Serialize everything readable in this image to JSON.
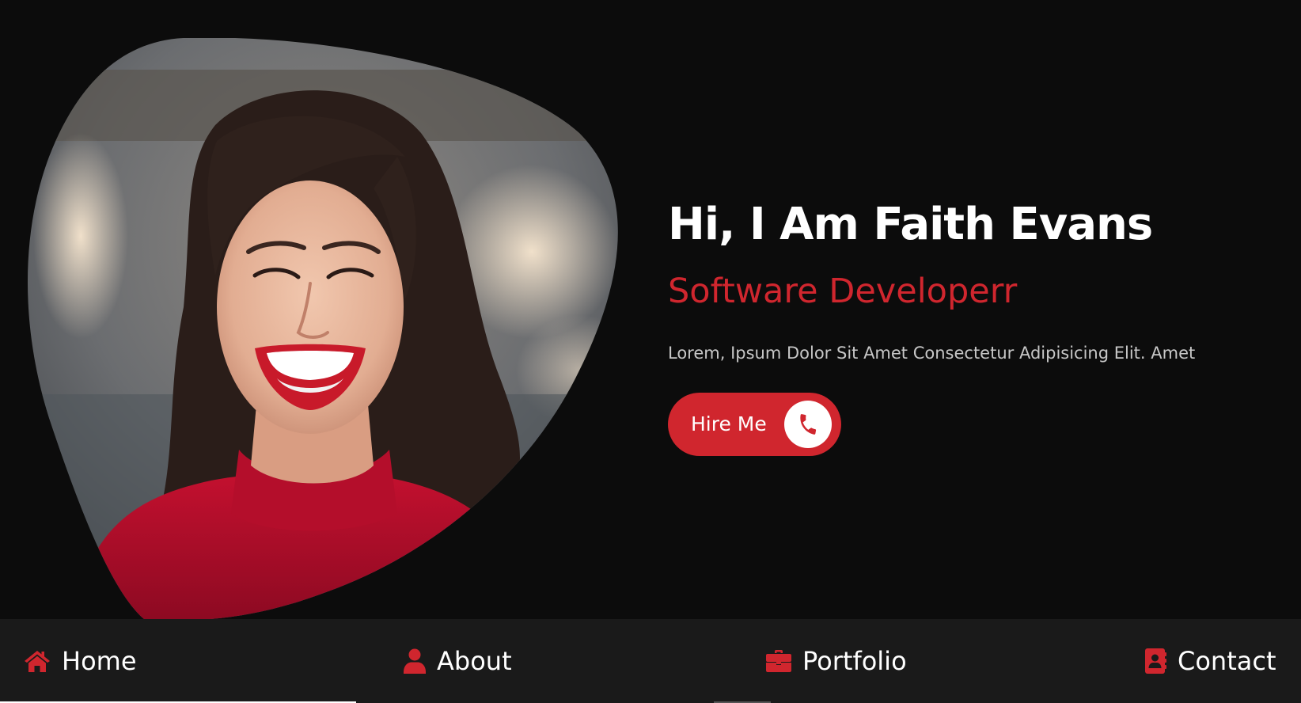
{
  "hero": {
    "title": "Hi, I Am Faith Evans",
    "role": "Software Developerr",
    "description": "Lorem, Ipsum Dolor Sit Amet Consectetur Adipisicing Elit. Amet",
    "hire_button_label": "Hire Me",
    "hire_button_icon": "phone-icon",
    "photo": "portrait-photo"
  },
  "nav": {
    "items": [
      {
        "label": "Home",
        "icon": "home-icon",
        "active": true
      },
      {
        "label": "About",
        "icon": "user-icon",
        "active": false
      },
      {
        "label": "Portfolio",
        "icon": "briefcase-icon",
        "active": false
      },
      {
        "label": "Contact",
        "icon": "contact-book-icon",
        "active": false
      }
    ]
  },
  "colors": {
    "background": "#0c0c0c",
    "nav_background": "#1a1a1a",
    "accent": "#d0262e",
    "text": "#ffffff",
    "muted_text": "#c7c7c7"
  }
}
